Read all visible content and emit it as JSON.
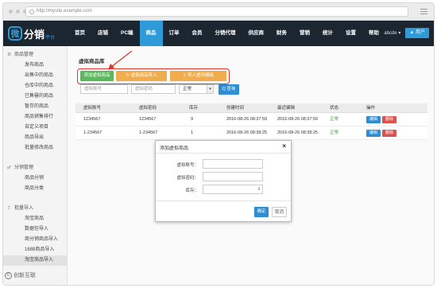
{
  "browser": {
    "url": "http://mysite.example.com"
  },
  "logo": {
    "mark": "微",
    "text": "分销",
    "sub": "平台"
  },
  "nav": {
    "items": [
      "首页",
      "店铺",
      "PC端",
      "商品",
      "订单",
      "会员",
      "分销代理",
      "供应商",
      "财务",
      "营销",
      "统计",
      "设置",
      "帮助"
    ],
    "active_index": 3,
    "user": "abcde ▾",
    "user_button": "▲ 用户"
  },
  "sidebar": {
    "sections": [
      {
        "title": "商品管理",
        "icon": "gear-icon",
        "items": [
          "发布商品",
          "出售中的商品",
          "仓库中的商品",
          "已售罄的商品",
          "暂存的商品",
          "商品销售排行",
          "自定义项目",
          "商品导出",
          "批量修改商品"
        ]
      },
      {
        "title": "分销管理",
        "icon": "share-icon",
        "items": [
          "商品分销",
          "商品分类"
        ]
      },
      {
        "title": "批量导入",
        "icon": "upload-icon",
        "items": [
          "淘宝商品",
          "数据包导入",
          "商分销商品导入",
          "1688商品导入",
          "淘宝商品导入"
        ]
      }
    ]
  },
  "main": {
    "title": "虚拟商品库",
    "actions": {
      "add": "添加虚拟商品",
      "import": "虚拟商品导入",
      "download": "导入虚拟模板"
    },
    "filters": {
      "account_placeholder": "虚拟账号",
      "password_placeholder": "虚拟密码",
      "status_value": "正常",
      "status_caret": "▾",
      "search": "Q 查询"
    },
    "table": {
      "headers": [
        "虚拟账号",
        "虚拟密码",
        "库存",
        "创建时间",
        "最近编辑",
        "状态",
        "操作"
      ],
      "rows": [
        {
          "account": "1234567",
          "password": "1234567",
          "stock": "9",
          "created": "2016-08-26 08:37:59",
          "edited": "2016-08-26 08:37:59",
          "status": "正常",
          "edit": "编辑",
          "delete": "删除"
        },
        {
          "account": "1-234567",
          "password": "1-234567",
          "stock": "1",
          "created": "2016-08-26 08:38:25",
          "edited": "2016-08-26 08:38:25",
          "status": "正常",
          "edit": "编辑",
          "delete": "删除"
        }
      ]
    }
  },
  "modal": {
    "title": "添加虚拟商品",
    "close": "×",
    "fields": {
      "account_label": "虚拟账号：",
      "password_label": "虚拟密码：",
      "stock_label": "库存：",
      "stock_spin": "⇕"
    },
    "confirm": "确定",
    "cancel": "取消"
  },
  "watermark": {
    "mark": "C",
    "text": "创新互联"
  },
  "colors": {
    "nav_bg": "#1c2631",
    "accent": "#2e9ad8",
    "green": "#5cb85c",
    "orange": "#f0ad4e",
    "red": "#d9534f",
    "highlight": "#d9352a"
  }
}
